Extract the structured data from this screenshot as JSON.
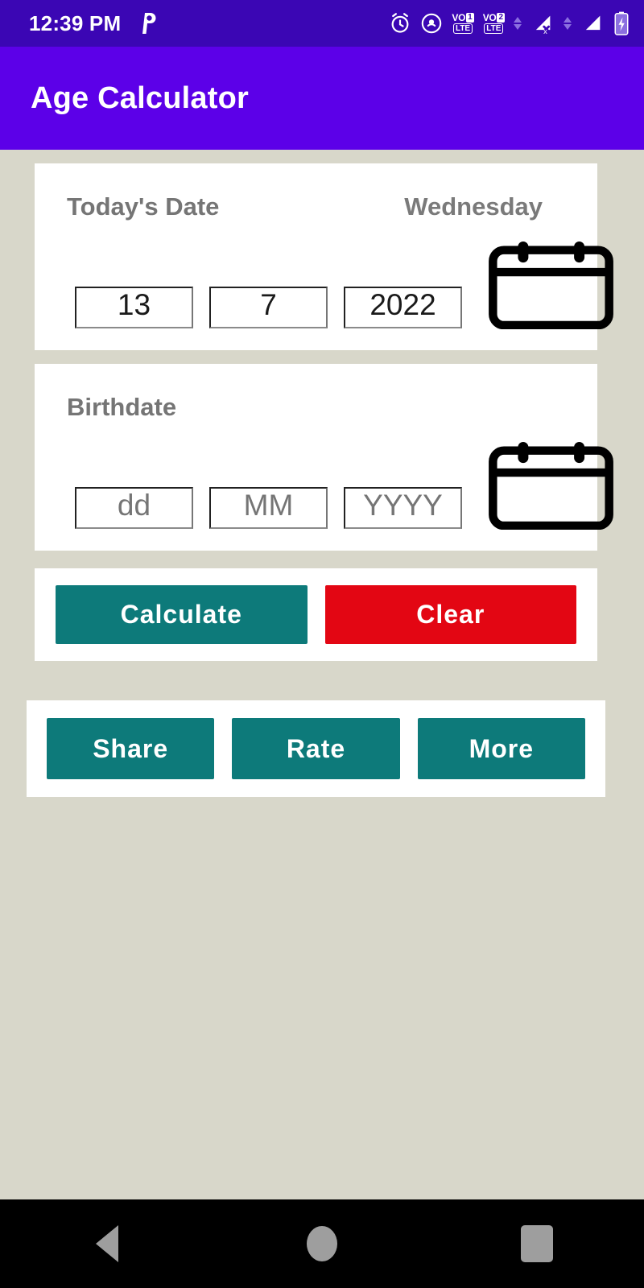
{
  "status_bar": {
    "time": "12:39 PM",
    "app_icon": "P",
    "icons": [
      "alarm-icon",
      "hotspot-icon",
      "volte-sim1-icon",
      "volte-sim2-icon",
      "data-transfer-arrows-icon",
      "signal-no-service-sim1-icon",
      "data-transfer-arrows-2-icon",
      "signal-bars-sim2-icon",
      "battery-charging-icon"
    ],
    "volte": [
      {
        "label": "VO",
        "sim": "1",
        "network": "LTE"
      },
      {
        "label": "VO",
        "sim": "2",
        "network": "LTE"
      }
    ],
    "background": "#3b06b4"
  },
  "app_bar": {
    "title": "Age Calculator",
    "background": "#5c00e8"
  },
  "today_card": {
    "label": "Today's Date",
    "weekday": "Wednesday",
    "day": "13",
    "month": "7",
    "year": "2022",
    "calendar_icon": "calendar-icon"
  },
  "birth_card": {
    "label": "Birthdate",
    "day": "",
    "month": "",
    "year": "",
    "day_placeholder": "dd",
    "month_placeholder": "MM",
    "year_placeholder": "YYYY",
    "calendar_icon": "calendar-icon"
  },
  "actions": {
    "calculate_label": "Calculate",
    "clear_label": "Clear",
    "calculate_color": "#0d7a7a",
    "clear_color": "#e30613"
  },
  "links": {
    "share_label": "Share",
    "rate_label": "Rate",
    "more_label": "More",
    "color": "#0d7a7a"
  },
  "nav_bar": {
    "back": "back-icon",
    "home": "home-icon",
    "recents": "recents-icon"
  },
  "theme": {
    "page_background": "#d8d7ca",
    "card_background": "#ffffff",
    "label_gray": "#757575"
  }
}
